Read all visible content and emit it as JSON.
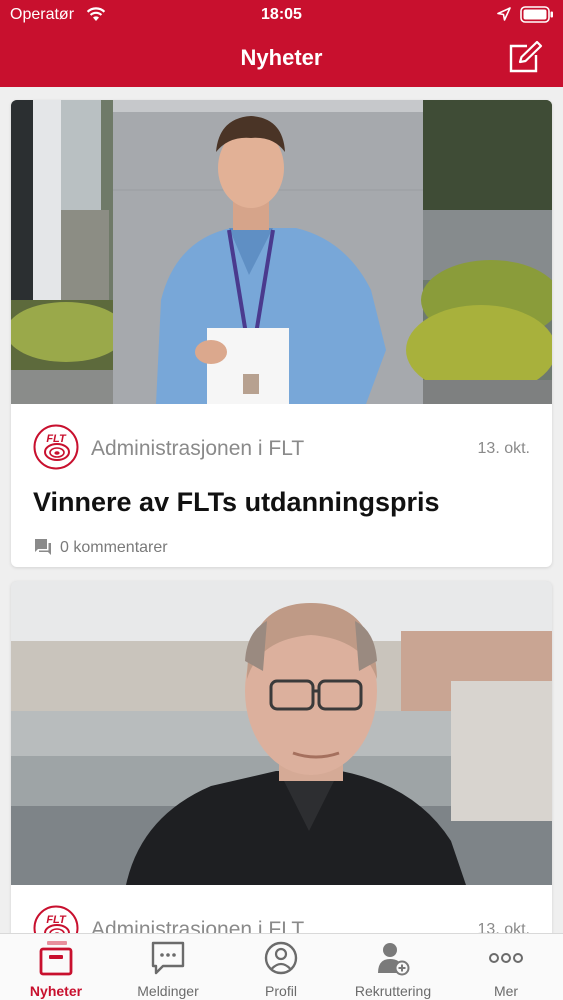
{
  "status": {
    "carrier": "Operatør",
    "time": "18:05"
  },
  "nav": {
    "title": "Nyheter"
  },
  "colors": {
    "brand": "#c8102e",
    "text": "#111111",
    "muted": "#8a8a8a"
  },
  "feed": {
    "items": [
      {
        "image": "man-in-blue-shirt-holding-paper",
        "author": "Administrasjonen i FLT",
        "date": "13. okt.",
        "headline": "Vinnere av FLTs utdanningspris",
        "comments": "0 kommentarer"
      },
      {
        "image": "bald-man-with-glasses-portrait",
        "author": "Administrasjonen i FLT",
        "date": "13. okt."
      }
    ]
  },
  "logo_text": "FLT",
  "tabs": [
    {
      "label": "Nyheter",
      "icon": "news-icon",
      "active": true
    },
    {
      "label": "Meldinger",
      "icon": "messages-icon",
      "active": false
    },
    {
      "label": "Profil",
      "icon": "profile-icon",
      "active": false
    },
    {
      "label": "Rekruttering",
      "icon": "recruit-icon",
      "active": false
    },
    {
      "label": "Mer",
      "icon": "more-icon",
      "active": false
    }
  ]
}
